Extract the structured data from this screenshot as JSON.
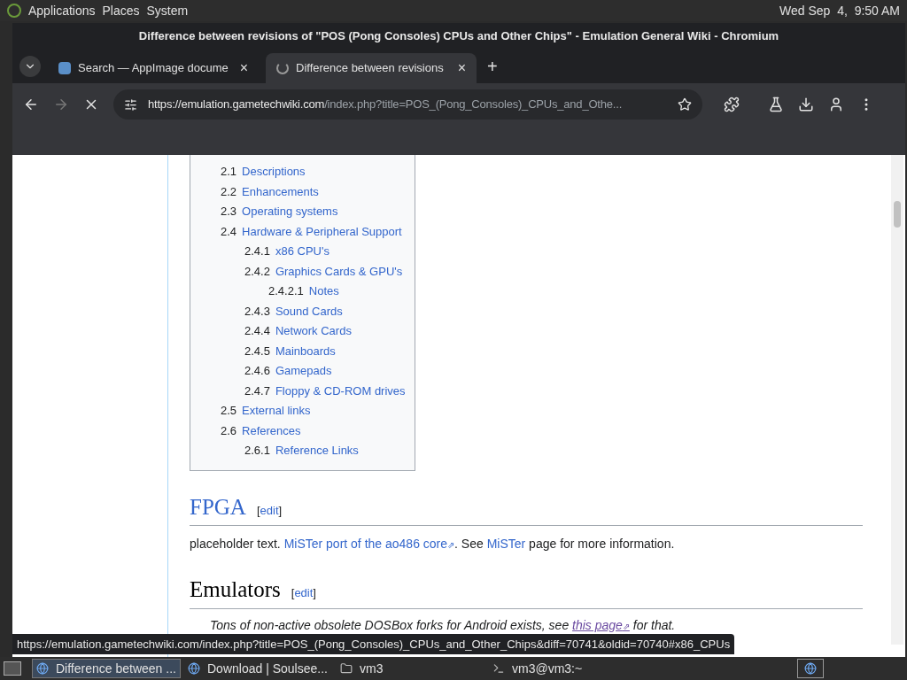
{
  "top_panel": {
    "menus": [
      "Applications",
      "Places",
      "System"
    ],
    "clock": "Wed Sep  4,  9:50 AM"
  },
  "window": {
    "title": "Difference between revisions of \"POS (Pong Consoles) CPUs and Other Chips\" - Emulation General Wiki - Chromium"
  },
  "tabs": [
    {
      "label": "Search — AppImage docume",
      "selected": false,
      "close": "×"
    },
    {
      "label": "Difference between revisions",
      "selected": true,
      "close": "×"
    }
  ],
  "new_tab": "+",
  "address": {
    "host": "https://emulation.gametechwiki.com",
    "path": "/index.php?title=POS_(Pong_Consoles)_CPUs_and_Othe..."
  },
  "toc": {
    "items": [
      {
        "number": "2.1",
        "text": "Descriptions"
      },
      {
        "number": "2.2",
        "text": "Enhancements"
      },
      {
        "number": "2.3",
        "text": "Operating systems"
      },
      {
        "number": "2.4",
        "text": "Hardware & Peripheral Support",
        "children": [
          {
            "number": "2.4.1",
            "text": "x86 CPU's"
          },
          {
            "number": "2.4.2",
            "text": "Graphics Cards & GPU's",
            "children": [
              {
                "number": "2.4.2.1",
                "text": "Notes"
              }
            ]
          },
          {
            "number": "2.4.3",
            "text": "Sound Cards"
          },
          {
            "number": "2.4.4",
            "text": "Network Cards"
          },
          {
            "number": "2.4.5",
            "text": "Mainboards"
          },
          {
            "number": "2.4.6",
            "text": "Gamepads"
          },
          {
            "number": "2.4.7",
            "text": "Floppy & CD-ROM drives"
          }
        ]
      },
      {
        "number": "2.5",
        "text": "External links"
      },
      {
        "number": "2.6",
        "text": "References",
        "children": [
          {
            "number": "2.6.1",
            "text": "Reference Links"
          }
        ]
      }
    ]
  },
  "sections": [
    {
      "title": "FPGA",
      "edit": {
        "open": "[",
        "label": "edit",
        "close": "]"
      },
      "paragraphs": [
        {
          "kind": "body",
          "parts": [
            {
              "kind": "text",
              "text": "placeholder text. "
            },
            {
              "kind": "external",
              "text": "MiSTer port of the ao486 core",
              "mark": "⇗"
            },
            {
              "kind": "text",
              "text": ". See "
            },
            {
              "kind": "link",
              "text": "MiSTer"
            },
            {
              "kind": "text",
              "text": " page for more information."
            }
          ]
        }
      ]
    },
    {
      "title": "Emulators",
      "edit": {
        "open": "[",
        "label": "edit",
        "close": "]"
      },
      "paragraphs": [
        {
          "kind": "note",
          "parts": [
            {
              "kind": "text",
              "text": "Tons of non-active obsolete DOSBox forks for Android exists, see "
            },
            {
              "kind": "visited_external",
              "text": "this page",
              "mark": "⇗"
            },
            {
              "kind": "text",
              "text": " for that."
            }
          ]
        }
      ]
    }
  ],
  "status_url": "https://emulation.gametechwiki.com/index.php?title=POS_(Pong_Consoles)_CPUs_and_Other_Chips&diff=70741&oldid=70740#x86_CPUs",
  "taskbar": [
    {
      "label": "Difference between ...",
      "kind": "browser",
      "selected": true
    },
    {
      "label": "Download | Soulsee...",
      "kind": "browser",
      "selected": false
    },
    {
      "label": "vm3",
      "kind": "folder",
      "selected": false
    },
    {
      "label": "vm3@vm3:~",
      "kind": "terminal",
      "selected": false
    }
  ]
}
